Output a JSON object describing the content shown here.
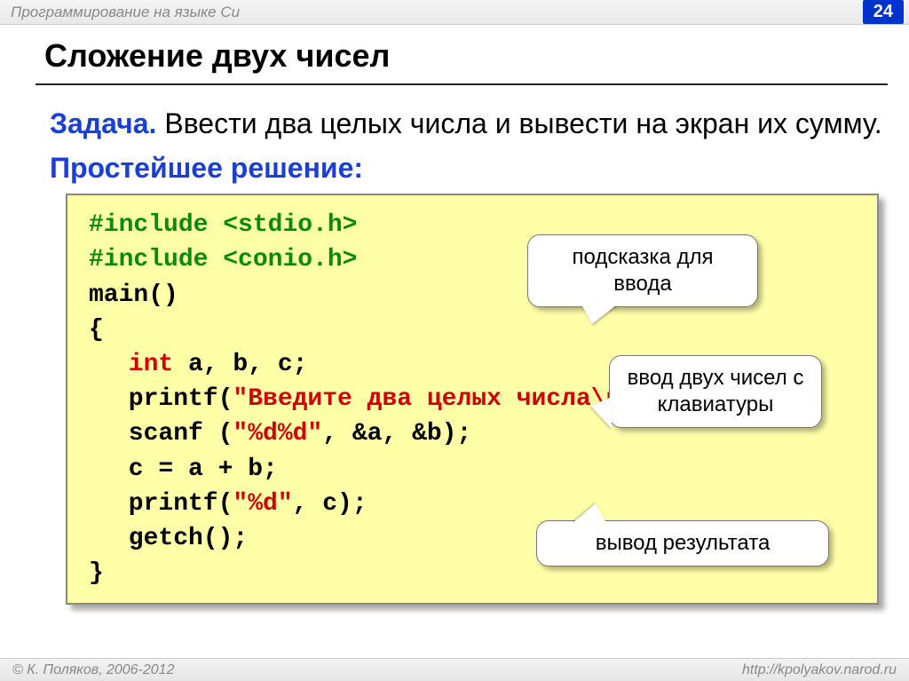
{
  "header": {
    "course": "Программирование на языке Си",
    "page_number": "24"
  },
  "slide": {
    "title": "Сложение двух чисел",
    "task_label": "Задача.",
    "task_text": " Ввести два целых числа и вывести на экран их сумму.",
    "solution_label": "Простейшее решение:"
  },
  "code": {
    "l1a": "#include ",
    "l1b": "<stdio.h>",
    "l2a": "#include ",
    "l2b": "<conio.h>",
    "l3": "main()",
    "l4": "{",
    "l5a": "int",
    "l5b": " a, b, c;",
    "l6a": "printf(",
    "l6b": "\"Введите два целых числа\\n\"",
    "l6c": ");",
    "l7a": "scanf (",
    "l7b": "\"%d%d\"",
    "l7c": ", &a, &b);",
    "l8": "c = a + b;",
    "l9a": "printf(",
    "l9b": "\"%d\"",
    "l9c": ", c);",
    "l10": "getch();",
    "l11": "}"
  },
  "callouts": {
    "c1": "подсказка для ввода",
    "c2": "ввод двух чисел с клавиатуры",
    "c3": "вывод результата"
  },
  "footer": {
    "copyright": "© К. Поляков, 2006-2012",
    "url": "http://kpolyakov.narod.ru"
  }
}
